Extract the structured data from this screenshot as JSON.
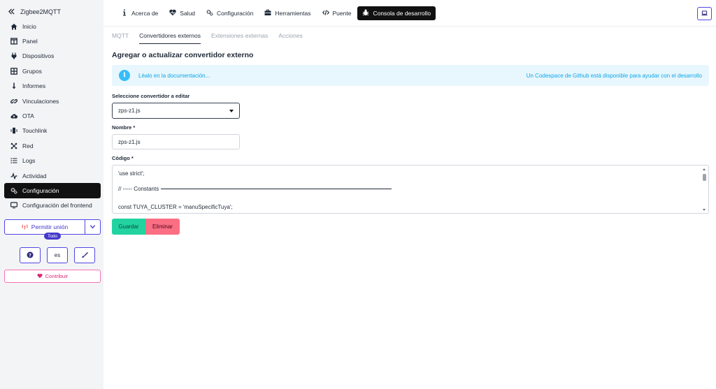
{
  "sidebar": {
    "brand": "Zigbee2MQTT",
    "items": [
      {
        "label": "Inicio",
        "icon": "home-icon"
      },
      {
        "label": "Panel",
        "icon": "table-columns-icon"
      },
      {
        "label": "Dispositivos",
        "icon": "plug-icon"
      },
      {
        "label": "Grupos",
        "icon": "grid-icon"
      },
      {
        "label": "Informes",
        "icon": "arrow-down-long-icon"
      },
      {
        "label": "Vinculaciones",
        "icon": "link-icon"
      },
      {
        "label": "OTA",
        "icon": "cloud-upload-icon"
      },
      {
        "label": "Touchlink",
        "icon": "mobile-vibrate-icon"
      },
      {
        "label": "Red",
        "icon": "network-icon"
      },
      {
        "label": "Logs",
        "icon": "list-icon"
      },
      {
        "label": "Actividad",
        "icon": "wave-icon"
      },
      {
        "label": "Configuración",
        "icon": "gears-icon",
        "active": true
      },
      {
        "label": "Configuración del frontend",
        "icon": "monitor-icon"
      }
    ],
    "permit_join": {
      "label": "Permitir unión",
      "badge": "Todo"
    },
    "mini_buttons": {
      "help": "?",
      "language": "es",
      "theme": "brush-icon"
    },
    "contribute": "Contribuir"
  },
  "topbar": {
    "tabs": [
      {
        "label": "Acerca de",
        "icon": "info-icon"
      },
      {
        "label": "Salud",
        "icon": "heart-pulse-icon"
      },
      {
        "label": "Configuración",
        "icon": "gears-icon"
      },
      {
        "label": "Herramientas",
        "icon": "toolbox-icon"
      },
      {
        "label": "Puente",
        "icon": "code-icon"
      },
      {
        "label": "Consola de desarrollo",
        "icon": "bug-icon",
        "active": true
      }
    ]
  },
  "subtabs": [
    {
      "label": "MQTT"
    },
    {
      "label": "Convertidores externos",
      "active": true
    },
    {
      "label": "Extensiones externas"
    },
    {
      "label": "Acciones"
    }
  ],
  "page": {
    "title": "Agregar o actualizar convertidor externo",
    "info_left": "Léalo en la documentación...",
    "info_right": "Un Codespace de Github está disponible para ayudar con el desarrollo",
    "select_label": "Seleccione convertidor a editar",
    "select_value": "zps-z1.js",
    "name_label": "Nombre *",
    "name_value": "zps-z1.js",
    "code_label": "Código *",
    "code_lines": [
      "'use strict';",
      "// ----- Constants",
      "const TUYA_CLUSTER = 'manuSpecificTuya';"
    ],
    "save_label": "Guardar",
    "delete_label": "Eliminar"
  },
  "colors": {
    "accent": "#4f46e5",
    "active_bg": "#111111",
    "save": "#22d3a0",
    "delete": "#fb6f84",
    "info_bg": "#e7f7fd",
    "info_text": "#0ea5e9",
    "contribute": "#db2777"
  }
}
